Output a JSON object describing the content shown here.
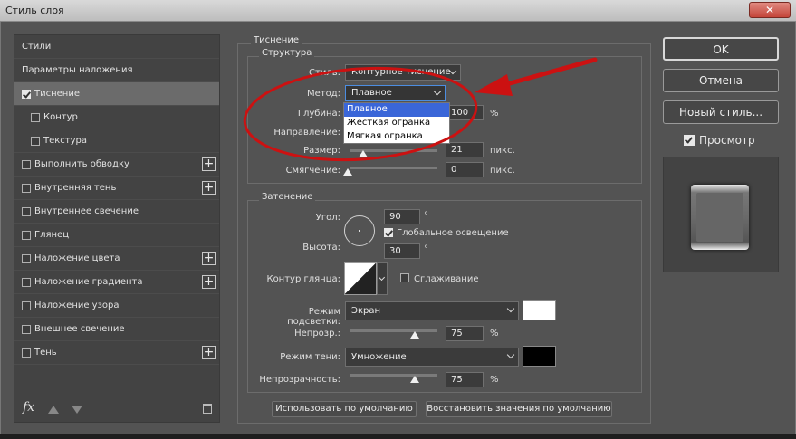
{
  "window": {
    "title": "Стиль слоя",
    "close_glyph": "✕"
  },
  "styles_list": {
    "items": [
      {
        "label": "Стили",
        "checkbox": false,
        "checked": false,
        "indent": false,
        "plus": false,
        "selected": false
      },
      {
        "label": "Параметры наложения",
        "checkbox": false,
        "checked": false,
        "indent": false,
        "plus": false,
        "selected": false
      },
      {
        "label": "Тиснение",
        "checkbox": true,
        "checked": true,
        "indent": false,
        "plus": false,
        "selected": true
      },
      {
        "label": "Контур",
        "checkbox": true,
        "checked": false,
        "indent": true,
        "plus": false,
        "selected": false
      },
      {
        "label": "Текстура",
        "checkbox": true,
        "checked": false,
        "indent": true,
        "plus": false,
        "selected": false
      },
      {
        "label": "Выполнить обводку",
        "checkbox": true,
        "checked": false,
        "indent": false,
        "plus": true,
        "selected": false
      },
      {
        "label": "Внутренняя тень",
        "checkbox": true,
        "checked": false,
        "indent": false,
        "plus": true,
        "selected": false
      },
      {
        "label": "Внутреннее свечение",
        "checkbox": true,
        "checked": false,
        "indent": false,
        "plus": false,
        "selected": false
      },
      {
        "label": "Глянец",
        "checkbox": true,
        "checked": false,
        "indent": false,
        "plus": false,
        "selected": false
      },
      {
        "label": "Наложение цвета",
        "checkbox": true,
        "checked": false,
        "indent": false,
        "plus": true,
        "selected": false
      },
      {
        "label": "Наложение градиента",
        "checkbox": true,
        "checked": false,
        "indent": false,
        "plus": true,
        "selected": false
      },
      {
        "label": "Наложение узора",
        "checkbox": true,
        "checked": false,
        "indent": false,
        "plus": false,
        "selected": false
      },
      {
        "label": "Внешнее свечение",
        "checkbox": true,
        "checked": false,
        "indent": false,
        "plus": false,
        "selected": false
      },
      {
        "label": "Тень",
        "checkbox": true,
        "checked": false,
        "indent": false,
        "plus": true,
        "selected": false
      }
    ],
    "footer": {
      "fx_label": "fx",
      "up_icon": "arrow-up-icon",
      "down_icon": "arrow-down-icon",
      "trash_icon": "trash-icon"
    }
  },
  "bevel": {
    "section_title": "Тиснение",
    "structure": {
      "title": "Структура",
      "style_label": "Стиль:",
      "style_value": "Контурное тиснение",
      "method_label": "Метод:",
      "method_value": "Плавное",
      "method_options": [
        "Плавное",
        "Жесткая огранка",
        "Мягкая огранка"
      ],
      "depth_label": "Глубина:",
      "depth_value": "100",
      "depth_unit": "%",
      "direction_label": "Направление:",
      "size_label": "Размер:",
      "size_value": "21",
      "size_unit": "пикс.",
      "soften_label": "Смягчение:",
      "soften_value": "0",
      "soften_unit": "пикс."
    },
    "shading": {
      "title": "Затенение",
      "angle_label": "Угол:",
      "angle_value": "90",
      "angle_unit": "°",
      "global_light_label": "Глобальное освещение",
      "global_light_checked": true,
      "altitude_label": "Высота:",
      "altitude_value": "30",
      "altitude_unit": "°",
      "gloss_contour_label": "Контур глянца:",
      "antialias_label": "Сглаживание",
      "antialias_checked": false,
      "highlight_mode_label": "Режим подсветки:",
      "highlight_mode_value": "Экран",
      "highlight_color": "#ffffff",
      "highlight_opacity_label": "Непрозр.:",
      "highlight_opacity_value": "75",
      "highlight_opacity_unit": "%",
      "shadow_mode_label": "Режим тени:",
      "shadow_mode_value": "Умножение",
      "shadow_color": "#000000",
      "shadow_opacity_label": "Непрозрачность:",
      "shadow_opacity_value": "75",
      "shadow_opacity_unit": "%"
    },
    "buttons": {
      "make_default": "Использовать по умолчанию",
      "reset_default": "Восстановить значения по умолчанию"
    }
  },
  "actions": {
    "ok": "OK",
    "cancel": "Отмена",
    "new_style": "Новый стиль...",
    "preview_label": "Просмотр",
    "preview_checked": true
  },
  "annotation": {
    "color": "#cc1111"
  }
}
